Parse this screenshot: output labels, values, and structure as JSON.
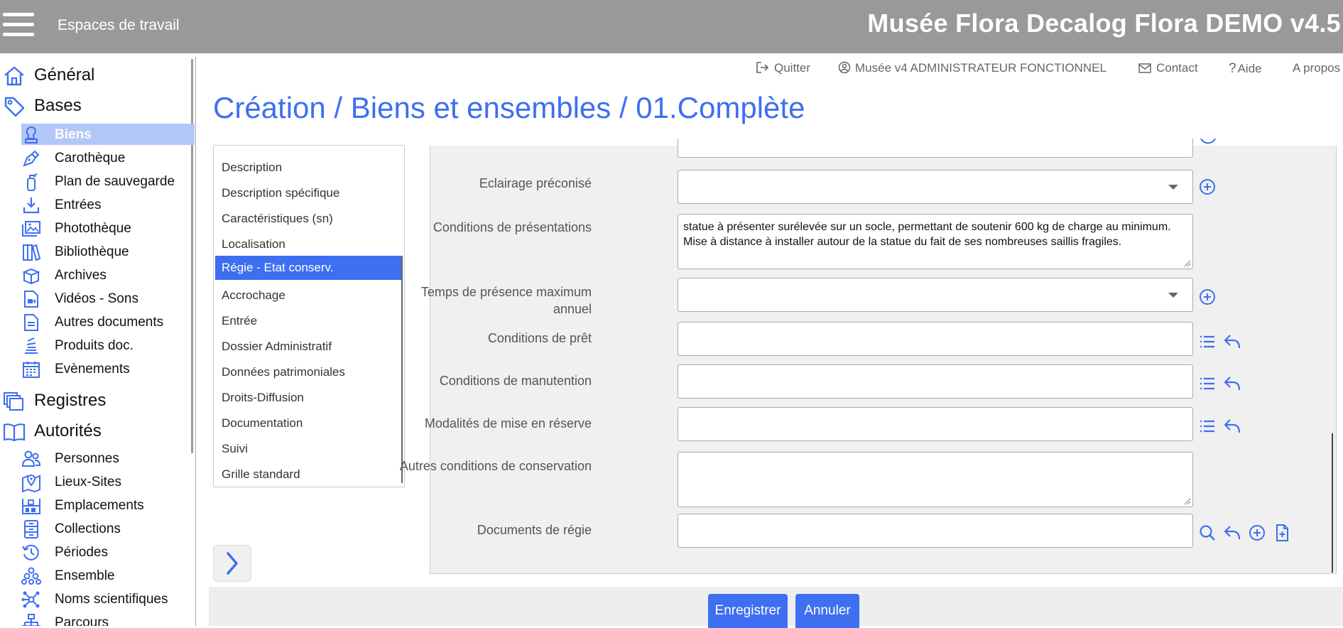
{
  "header": {
    "workspaces_label": "Espaces de travail",
    "app_title": "Musée Flora Decalog Flora DEMO v4.5",
    "background_color": "#999999"
  },
  "usernav": {
    "quit": "Quitter",
    "user": "Musée v4 ADMINISTRATEUR FONCTIONNEL",
    "contact": "Contact",
    "help": "Aide",
    "about": "A propos"
  },
  "page_title": "Création / Biens et ensembles / 01.Complète",
  "sidebar": {
    "sections": [
      {
        "label": "Général",
        "icon": "home-icon"
      },
      {
        "label": "Bases",
        "icon": "tag-icon"
      },
      {
        "label": "Registres",
        "icon": "registers-icon"
      },
      {
        "label": "Autorités",
        "icon": "book-icon"
      }
    ],
    "bases_items": [
      {
        "label": "Biens",
        "icon": "bust-icon",
        "active": true
      },
      {
        "label": "Carothèque",
        "icon": "pen-nib-icon"
      },
      {
        "label": "Plan de sauvegarde",
        "icon": "fire-extinguisher-icon"
      },
      {
        "label": "Entrées",
        "icon": "download-icon"
      },
      {
        "label": "Photothèque",
        "icon": "images-icon"
      },
      {
        "label": "Bibliothèque",
        "icon": "books-icon"
      },
      {
        "label": "Archives",
        "icon": "archive-box-icon"
      },
      {
        "label": "Vidéos - Sons",
        "icon": "video-file-icon"
      },
      {
        "label": "Autres documents",
        "icon": "document-icon"
      },
      {
        "label": "Produits doc.",
        "icon": "stack-icon"
      },
      {
        "label": "Evènements",
        "icon": "calendar-icon"
      }
    ],
    "autorites_items": [
      {
        "label": "Personnes",
        "icon": "people-icon"
      },
      {
        "label": "Lieux-Sites",
        "icon": "map-pin-icon"
      },
      {
        "label": "Emplacements",
        "icon": "shelf-icon"
      },
      {
        "label": "Collections",
        "icon": "cabinet-icon"
      },
      {
        "label": "Périodes",
        "icon": "history-icon"
      },
      {
        "label": "Ensemble",
        "icon": "cluster-icon"
      },
      {
        "label": "Noms scientifiques",
        "icon": "network-icon"
      },
      {
        "label": "Parcours",
        "icon": "sitemap-icon"
      }
    ]
  },
  "tabs": [
    {
      "label": "Description"
    },
    {
      "label": "Description spécifique"
    },
    {
      "label": "Caractéristiques (sn)"
    },
    {
      "label": "Localisation"
    },
    {
      "label": "Régie - Etat conserv.",
      "active": true
    },
    {
      "label": "Accrochage"
    },
    {
      "label": "Entrée"
    },
    {
      "label": "Dossier Administratif"
    },
    {
      "label": "Données patrimoniales"
    },
    {
      "label": "Droits-Diffusion"
    },
    {
      "label": "Documentation"
    },
    {
      "label": "Suivi"
    },
    {
      "label": "Grille standard"
    }
  ],
  "form": {
    "eclairage": {
      "label": "Eclairage préconisé",
      "value": ""
    },
    "conditions_presentation": {
      "label": "Conditions de présentations",
      "value": "statue à présenter surélevée sur un socle, permettant de soutenir 600 kg de charge au minimum. Mise à distance à installer autour de la statue du fait de ses nombreuses saillis fragiles."
    },
    "temps_presence": {
      "label_line1": "Temps de présence maximum",
      "label_line2": "annuel",
      "value": ""
    },
    "conditions_pret": {
      "label": "Conditions de prêt",
      "value": ""
    },
    "conditions_manutention": {
      "label": "Conditions de manutention",
      "value": ""
    },
    "modalites_reserve": {
      "label": "Modalités de mise en réserve",
      "value": ""
    },
    "autres_conditions": {
      "label": "Autres conditions de conservation",
      "value": ""
    },
    "documents_regie": {
      "label": "Documents de régie",
      "value": ""
    }
  },
  "buttons": {
    "save": "Enregistrer",
    "cancel": "Annuler"
  },
  "colors": {
    "accent": "#3d6ff0",
    "active_sidebar": "#b3c7f7",
    "panel_bg": "#f0f0f0"
  }
}
